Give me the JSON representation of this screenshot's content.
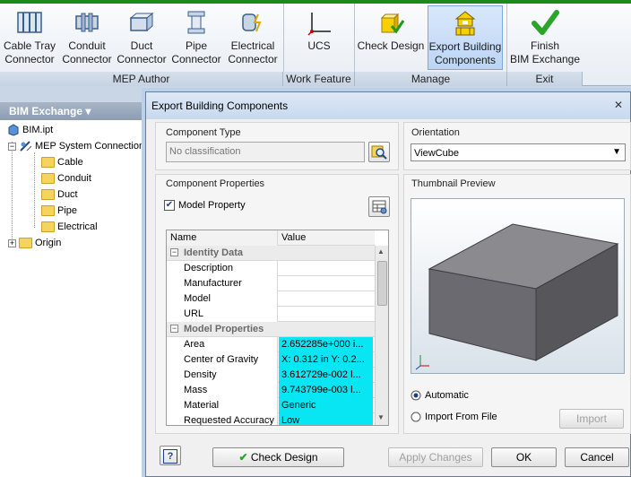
{
  "ribbon": {
    "buttons": [
      {
        "label1": "Cable Tray",
        "label2": "Connector"
      },
      {
        "label1": "Conduit",
        "label2": "Connector"
      },
      {
        "label1": "Duct",
        "label2": "Connector"
      },
      {
        "label1": "Pipe",
        "label2": "Connector"
      },
      {
        "label1": "Electrical",
        "label2": "Connector"
      },
      {
        "label1": "UCS",
        "label2": ""
      },
      {
        "label1": "Check Design",
        "label2": ""
      },
      {
        "label1": "Export Building",
        "label2": "Components"
      },
      {
        "label1": "Finish",
        "label2": "BIM Exchange"
      }
    ],
    "groups": [
      "MEP Author",
      "Work Feature",
      "Manage",
      "Exit"
    ]
  },
  "browser": {
    "title": "BIM Exchange",
    "items": [
      "BIM.ipt",
      "MEP System Connection",
      "Cable",
      "Conduit",
      "Duct",
      "Pipe",
      "Electrical",
      "Origin"
    ]
  },
  "dialog": {
    "title": "Export Building Components",
    "component_type_label": "Component Type",
    "component_type_placeholder": "No classification",
    "orientation_label": "Orientation",
    "orientation_value": "ViewCube",
    "component_properties_label": "Component Properties",
    "model_property_label": "Model Property",
    "thumbnail_label": "Thumbnail Preview",
    "grid": {
      "col_name": "Name",
      "col_value": "Value",
      "cat1": "Identity Data",
      "identity": [
        {
          "name": "Description",
          "value": ""
        },
        {
          "name": "Manufacturer",
          "value": ""
        },
        {
          "name": "Model",
          "value": ""
        },
        {
          "name": "URL",
          "value": ""
        }
      ],
      "cat2": "Model Properties",
      "model": [
        {
          "name": "Area",
          "value": "2.652285e+000 i..."
        },
        {
          "name": "Center of Gravity",
          "value": "X: 0.312 in Y: 0.2..."
        },
        {
          "name": "Density",
          "value": "3.612729e-002 l..."
        },
        {
          "name": "Mass",
          "value": "9.743799e-003 l..."
        },
        {
          "name": "Material",
          "value": "Generic"
        },
        {
          "name": "Requested Accuracy",
          "value": "Low"
        }
      ]
    },
    "automatic_label": "Automatic",
    "import_from_file_label": "Import From File",
    "import_button": "Import",
    "check_design_button": "Check Design",
    "apply_changes_button": "Apply Changes",
    "ok_button": "OK",
    "cancel_button": "Cancel",
    "help_button": "?"
  },
  "colors": {
    "highlight": "#08e6f4",
    "cube": "#5e5e63"
  }
}
